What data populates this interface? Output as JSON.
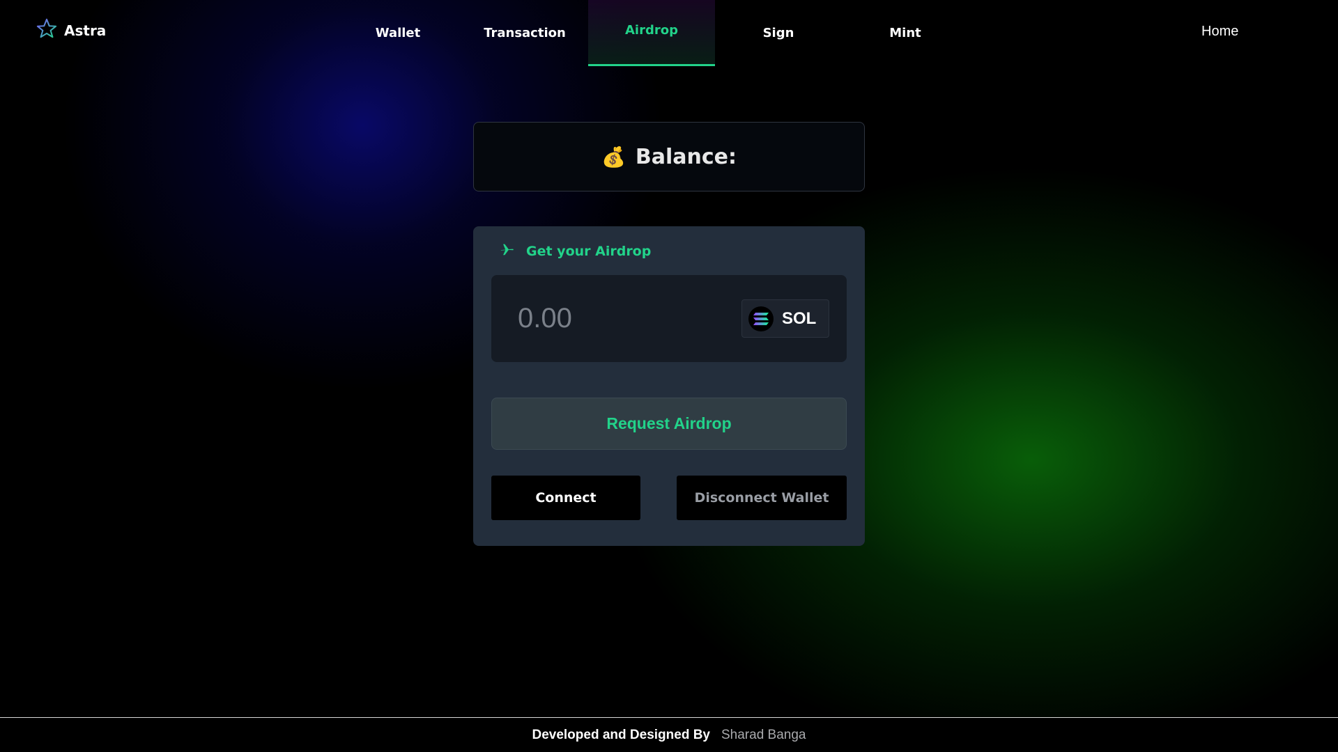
{
  "brand": {
    "name": "Astra",
    "icon": "star-outline-icon"
  },
  "nav": {
    "tabs": [
      {
        "label": "Wallet",
        "active": false
      },
      {
        "label": "Transaction",
        "active": false
      },
      {
        "label": "Airdrop",
        "active": true
      },
      {
        "label": "Sign",
        "active": false
      },
      {
        "label": "Mint",
        "active": false
      }
    ],
    "home_label": "Home"
  },
  "balance": {
    "icon": "💰",
    "label": "Balance:"
  },
  "airdrop": {
    "title": "Get your Airdrop",
    "title_icon": "plane-icon",
    "amount_placeholder": "0.00",
    "token": "SOL",
    "token_icon": "solana-logo-icon",
    "request_label": "Request Airdrop",
    "connect_label": "Connect",
    "disconnect_label": "Disconnect Wallet"
  },
  "footer": {
    "label": "Developed and Designed By",
    "author": "Sharad Banga"
  },
  "colors": {
    "accent": "#22d38a",
    "panel": "#232e3c",
    "input_bg": "#151b24"
  }
}
